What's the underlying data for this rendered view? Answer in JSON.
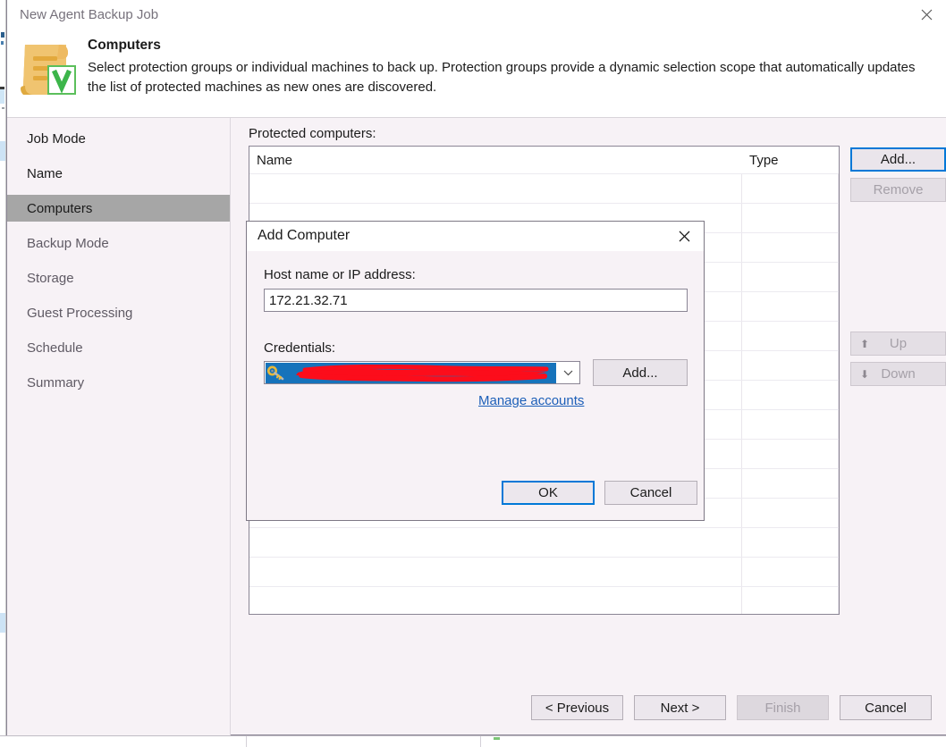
{
  "window": {
    "title": "New Agent Backup Job",
    "close_icon": "close-icon"
  },
  "header": {
    "icon": "veeam-protection-group-icon",
    "title": "Computers",
    "description": "Select protection groups or individual machines to back up. Protection groups provide a dynamic selection scope that automatically updates the list of protected machines as new ones are discovered."
  },
  "sidebar": {
    "items": [
      {
        "label": "Job Mode",
        "active": false,
        "strong": true
      },
      {
        "label": "Name",
        "active": false,
        "strong": true
      },
      {
        "label": "Computers",
        "active": true,
        "strong": true
      },
      {
        "label": "Backup Mode",
        "active": false,
        "strong": false
      },
      {
        "label": "Storage",
        "active": false,
        "strong": false
      },
      {
        "label": "Guest Processing",
        "active": false,
        "strong": false
      },
      {
        "label": "Schedule",
        "active": false,
        "strong": false
      },
      {
        "label": "Summary",
        "active": false,
        "strong": false
      }
    ]
  },
  "main": {
    "list_label": "Protected computers:",
    "table": {
      "columns": [
        "Name",
        "Type"
      ],
      "rows": []
    },
    "side_buttons": [
      {
        "label": "Add...",
        "state": "focused",
        "icon": null
      },
      {
        "label": "Remove",
        "state": "disabled",
        "icon": null
      },
      {
        "label": "Up",
        "state": "disabled",
        "icon": "arrow-up-icon"
      },
      {
        "label": "Down",
        "state": "disabled",
        "icon": "arrow-down-icon"
      }
    ]
  },
  "footer": {
    "buttons": [
      {
        "label": "< Previous",
        "state": "enabled"
      },
      {
        "label": "Next >",
        "state": "enabled"
      },
      {
        "label": "Finish",
        "state": "disabled"
      },
      {
        "label": "Cancel",
        "state": "enabled"
      }
    ]
  },
  "modal": {
    "title": "Add Computer",
    "close_icon": "close-icon",
    "host_label": "Host name or IP address:",
    "host_value": "172.21.32.71",
    "host_placeholder": "",
    "credentials_label": "Credentials:",
    "credentials_value": "",
    "credentials_redacted": true,
    "credentials_icon": "key-icon",
    "credentials_dropdown_icon": "chevron-down-icon",
    "credentials_add_label": "Add...",
    "manage_accounts_label": "Manage accounts",
    "ok_label": "OK",
    "cancel_label": "Cancel"
  },
  "colors": {
    "accent_focus": "#0078d7",
    "selection_blue": "#1673bb",
    "redaction_red": "#fc0d1b",
    "link_blue": "#1c5fb8",
    "panel_bg": "#f7f2f6",
    "active_nav": "#a6a6a6"
  }
}
